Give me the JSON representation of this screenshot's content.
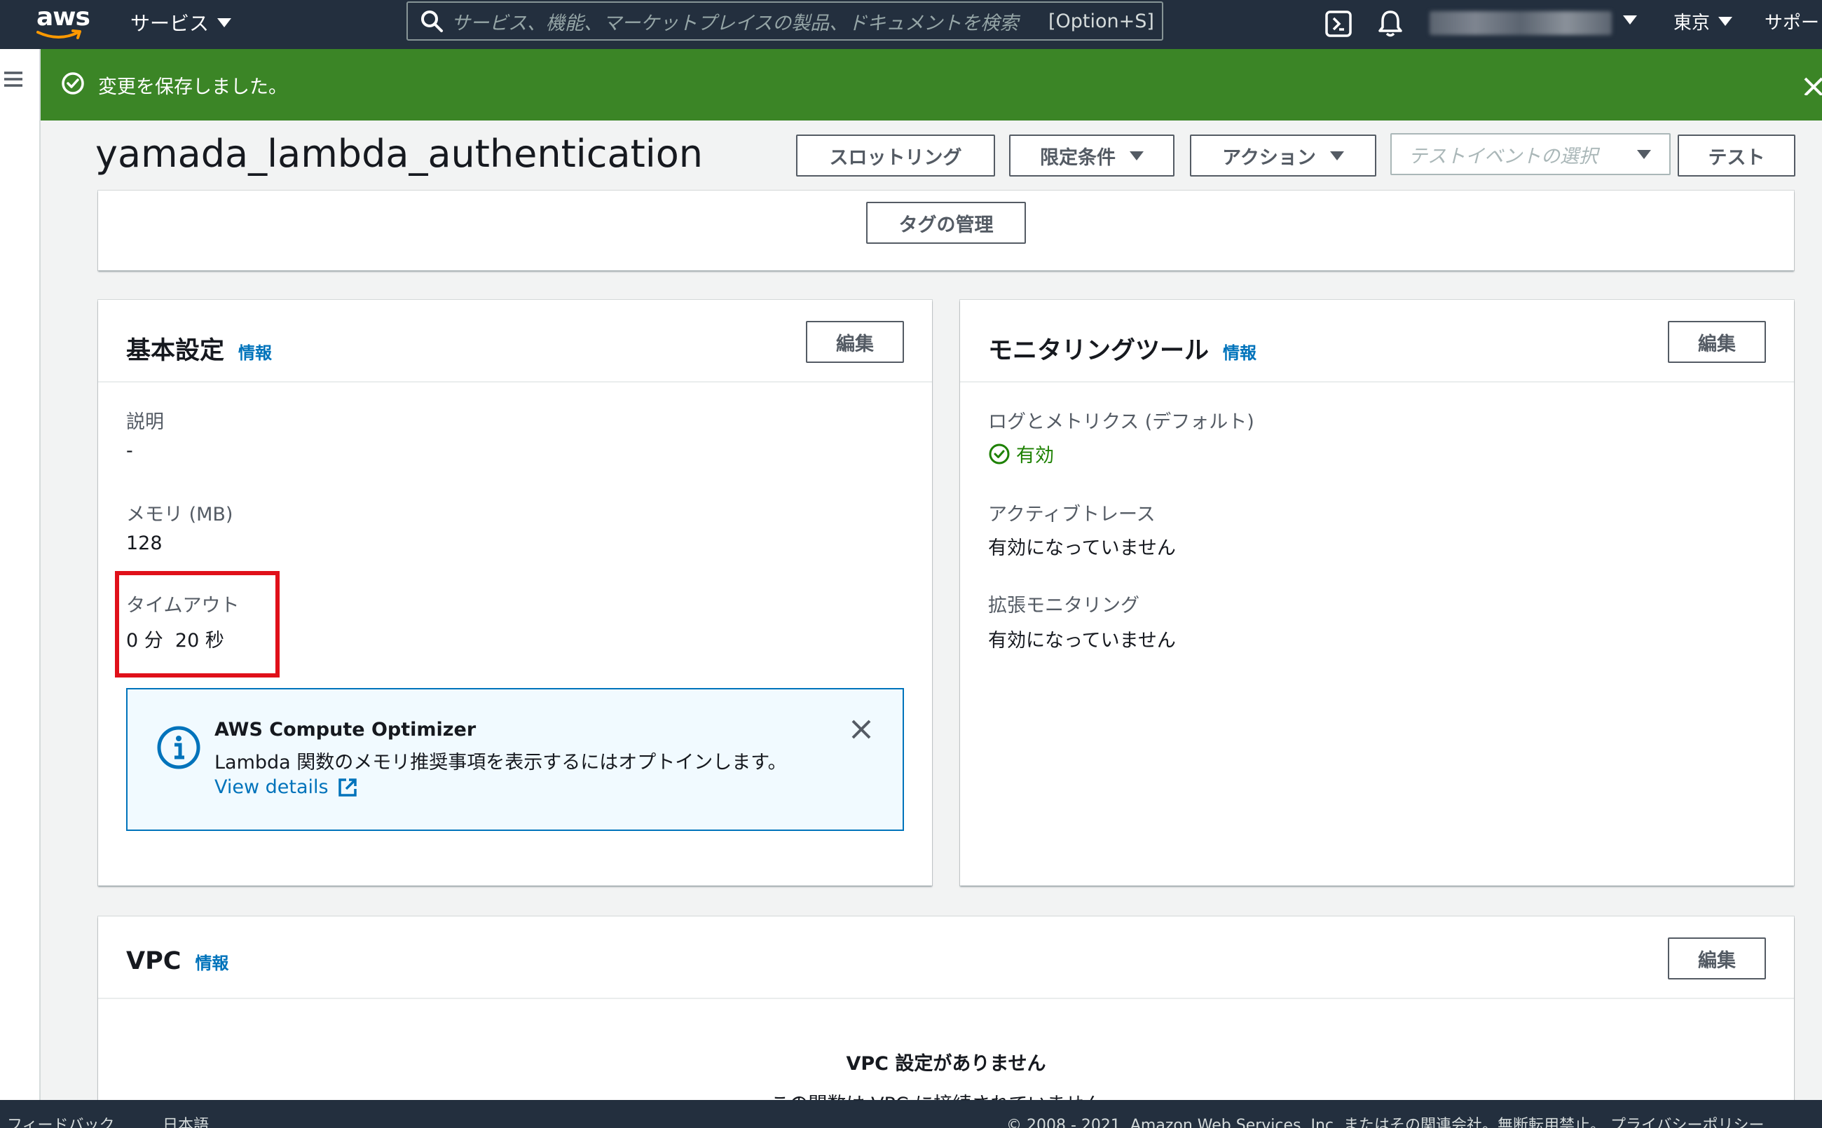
{
  "nav": {
    "logo_text": "aws",
    "services_label": "サービス",
    "search_placeholder": "サービス、機能、マーケットプレイスの製品、ドキュメントを検索",
    "search_shortcut": "[Option+S]",
    "region_label": "東京",
    "support_label": "サポート"
  },
  "flash": {
    "message": "変更を保存しました。"
  },
  "header": {
    "function_name": "yamada_lambda_authentication",
    "buttons": {
      "throttle": "スロットリング",
      "qualifiers": "限定条件",
      "actions": "アクション",
      "test": "テスト"
    },
    "test_event_placeholder": "テストイベントの選択"
  },
  "tags": {
    "manage_label": "タグの管理"
  },
  "general_config": {
    "title": "基本設定",
    "info": "情報",
    "edit": "編集",
    "description_label": "説明",
    "description_value": "-",
    "memory_label": "メモリ (MB)",
    "memory_value": "128",
    "timeout_label": "タイムアウト",
    "timeout_value": "0 分  20 秒"
  },
  "optimizer": {
    "title": "AWS Compute Optimizer",
    "body": "Lambda 関数のメモリ推奨事項を表示するにはオプトインします。",
    "link": "View details"
  },
  "monitoring": {
    "title": "モニタリングツール",
    "info": "情報",
    "edit": "編集",
    "logs_label": "ログとメトリクス (デフォルト)",
    "logs_value": "有効",
    "tracing_label": "アクティブトレース",
    "tracing_value": "有効になっていません",
    "enhanced_label": "拡張モニタリング",
    "enhanced_value": "有効になっていません"
  },
  "vpc": {
    "title": "VPC",
    "info": "情報",
    "edit": "編集",
    "empty_title": "VPC 設定がありません",
    "empty_body": "この関数は VPC に接続されていません。"
  },
  "footer": {
    "feedback": "フィードバック",
    "language": "日本語",
    "copyright": "© 2008 - 2021, Amazon Web Services, Inc. またはその関連会社。無断転用禁止。",
    "privacy": "プライバシーポリシー"
  },
  "colors": {
    "nav_bg": "#232f3e",
    "flash_success": "#3b8526",
    "link": "#0073bb",
    "status_ok": "#1d8102",
    "highlight": "#e0101a"
  }
}
